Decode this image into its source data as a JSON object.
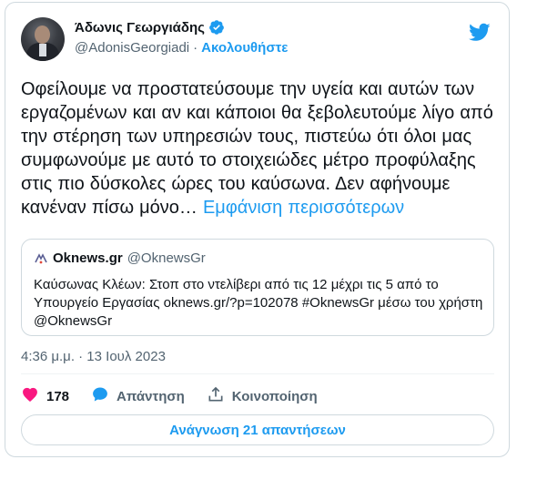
{
  "author": {
    "name": "Άδωνις Γεωργιάδης",
    "handle": "@AdonisGeorgiadi",
    "separator": "·",
    "follow_label": "Ακολουθήστε"
  },
  "tweet": {
    "text": "Οφείλουμε να προστατεύσουμε την υγεία και αυτών των εργαζομένων και αν και κάποιοι θα ξεβολευτούμε λίγο από την στέρηση των υπηρεσιών τους, πιστεύω ότι όλοι μας συμφωνούμε με αυτό το στοιχειώδες μέτρο προφύλαξης στις πιο δύσκολες ώρες του καύσωνα. Δεν αφήνουμε κανέναν πίσω μόνο…",
    "show_more": "Εμφάνιση περισσότερων"
  },
  "quote": {
    "name": "Oknews.gr",
    "handle": "@OknewsGr",
    "text": "Καύσωνας Κλέων: Στοπ στο ντελίβερι από τις 12 μέχρι τις 5 από το Υπουργείο Εργασίας oknews.gr/?p=102078 #OknewsGr μέσω του χρήστη @OknewsGr"
  },
  "timestamp": "4:36 μ.μ. · 13 Ιουλ 2023",
  "actions": {
    "likes": "178",
    "reply_label": "Απάντηση",
    "share_label": "Κοινοποίηση"
  },
  "read_replies_label": "Ανάγνωση 21 απαντήσεων",
  "colors": {
    "accent": "#1d9bf0",
    "like": "#f91880",
    "muted": "#536471",
    "border": "#cfd9de"
  },
  "icons": [
    "verified-badge-icon",
    "twitter-bird-icon",
    "heart-icon",
    "reply-bubble-icon",
    "share-icon",
    "oknews-logo-icon"
  ]
}
